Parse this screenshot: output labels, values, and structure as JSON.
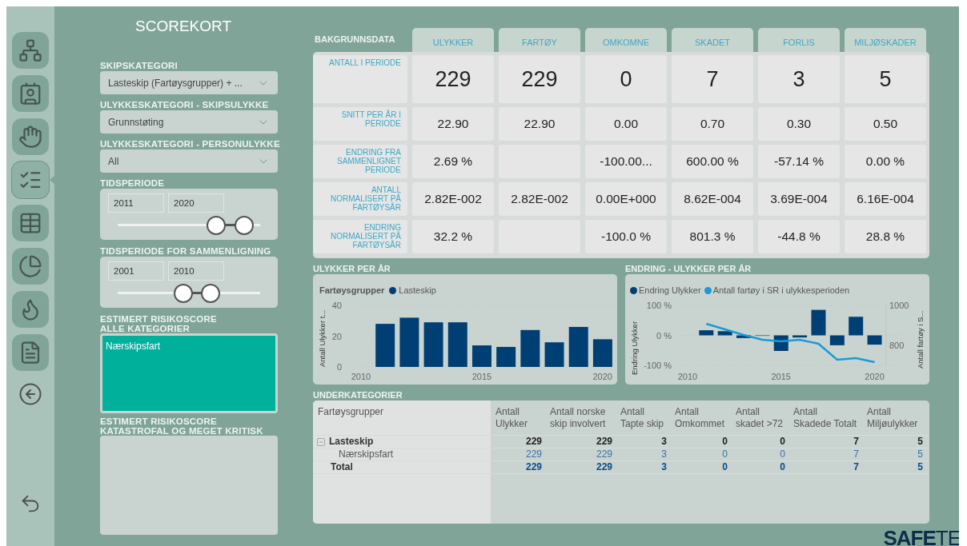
{
  "sidebar": {
    "nav_items": [
      {
        "kind": "network",
        "selected": false
      },
      {
        "kind": "contact",
        "selected": false
      },
      {
        "kind": "hand",
        "selected": false
      },
      {
        "kind": "checklist",
        "selected": true
      },
      {
        "kind": "table",
        "selected": false
      },
      {
        "kind": "pie",
        "selected": false
      },
      {
        "kind": "flame",
        "selected": false
      },
      {
        "kind": "document",
        "selected": false
      }
    ]
  },
  "filters": {
    "title": "SCOREKORT",
    "dropdowns": [
      {
        "label": "SKIPSKATEGORI",
        "value": "Lasteskip (Fartøysgrupper) + ..."
      },
      {
        "label": "ULYKKESKATEGORI - SKIPSULYKKE",
        "value": "Grunnstøting"
      },
      {
        "label": "ULYKKESKATEGORI - PERSONULYKKE",
        "value": "All"
      }
    ],
    "ranges": [
      {
        "label": "TIDSPERIODE",
        "from": "2011",
        "to": "2020",
        "thumbs": [
          {
            "level": 0.69
          },
          {
            "level": 0.89
          }
        ]
      },
      {
        "label": "TIDSPERIODE FOR SAMMENLIGNING",
        "from": "2001",
        "to": "2010",
        "thumbs": [
          {
            "level": 0.46
          },
          {
            "level": 0.65
          }
        ]
      }
    ],
    "risk_boxes": [
      {
        "label": [
          "ESTIMERT RISIKOSCORE",
          "ALLE KATEGORIER"
        ],
        "color": "#00b09b",
        "items": [
          "Nærskipsfart"
        ]
      },
      {
        "label": [
          "ESTIMERT RISIKOSCORE",
          "KATASTROFAL OG MEGET KRITISK"
        ]
      }
    ]
  },
  "scorecard": {
    "title": "BAKGRUNNSDATA",
    "columns": [
      "ULYKKER",
      "FARTØY",
      "OMKOMNE",
      "SKADET",
      "FORLIS",
      "MILJØSKADER"
    ],
    "rows": [
      {
        "label": "ANTALL I PERIODE",
        "values": [
          {
            "text": "229"
          },
          {
            "text": "229"
          },
          {
            "text": "0"
          },
          {
            "text": "7"
          },
          {
            "text": "3"
          },
          {
            "text": "5"
          }
        ]
      },
      {
        "label": "SNITT PER ÅR I PERIODE",
        "values": [
          {
            "text": "22.90"
          },
          {
            "text": "22.90"
          },
          {
            "text": "0.00"
          },
          {
            "text": "0.70"
          },
          {
            "text": "0.30"
          },
          {
            "text": "0.50"
          }
        ]
      },
      {
        "label": "ENDRING FRA SAMMENLIGNET PERIODE",
        "values": [
          {
            "text": "2.69 %"
          },
          {
            "empty": true
          },
          {
            "text": "-100.00..."
          },
          {
            "text": "600.00 %"
          },
          {
            "text": "-57.14 %"
          },
          {
            "text": "0.00 %"
          }
        ]
      },
      {
        "label": "ANTALL NORMALISERT PÅ FARTØYSÅR",
        "values": [
          {
            "text": "2.82E-002"
          },
          {
            "text": "2.82E-002"
          },
          {
            "text": "0.00E+000"
          },
          {
            "text": "8.62E-004"
          },
          {
            "text": "3.69E-004"
          },
          {
            "text": "6.16E-004"
          }
        ]
      },
      {
        "label": "ENDRING NORMALISERT PÅ FARTØYSÅR",
        "values": [
          {
            "text": "32.2 %"
          },
          {
            "empty": true
          },
          {
            "text": "-100.0 %"
          },
          {
            "text": "801.3 %"
          },
          {
            "text": "-44.8 %"
          },
          {
            "text": "28.8 %"
          }
        ]
      }
    ]
  },
  "charts": [
    {
      "title": "ULYKKER PER ÅR",
      "chart_data": {
        "type": "bar",
        "legend": "top",
        "title": "Fartøysgrupper",
        "ylabel": "Antall Ulykker t...",
        "x": [
          2011,
          2012,
          2013,
          2014,
          2015,
          2016,
          2017,
          2018,
          2019,
          2020
        ],
        "series": [
          {
            "name": "Lasteskip",
            "color": "#003f74",
            "values": [
              28,
              32,
              29,
              29,
              14,
              13,
              24,
              16,
              26,
              18
            ]
          }
        ],
        "xlim": [
          2010,
          2020.5
        ],
        "ylim": [
          0,
          40
        ],
        "xticks": [
          2010,
          2015,
          2020
        ],
        "yticks": [
          0,
          20,
          40
        ]
      }
    },
    {
      "title": "ENDRING - ULYKKER PER ÅR",
      "chart_data": {
        "type": "bar",
        "legend": "top",
        "ylabel": "Endring Ulykker",
        "y2label": "Antall fartøy i S...",
        "x": [
          2011,
          2012,
          2013,
          2014,
          2015,
          2016,
          2017,
          2018,
          2019,
          2020
        ],
        "series": [
          {
            "name": "Endring Ulykker",
            "type": "bar",
            "color": "#003f74",
            "values": [
              17,
              14,
              -9,
              0,
              -52,
              -7,
              85,
              -33,
              62,
              -31
            ]
          },
          {
            "name": "Antall fartøy i SR i ulykkesperioden",
            "type": "line",
            "axis": "y2",
            "color": "#1a9ad6",
            "values": [
              908,
              880,
              852,
              828,
              820,
              828,
              808,
              728,
              736,
              716
            ]
          }
        ],
        "xlim": [
          2009.6,
          2021.5
        ],
        "ylim": [
          -100,
          100
        ],
        "y2lim": [
          700,
          1000
        ],
        "xticks": [
          2010,
          2015,
          2020
        ],
        "yticks": [
          {
            "value": -100,
            "label": "-100 %"
          },
          {
            "value": 0,
            "label": "0 %"
          },
          {
            "value": 100,
            "label": "100 %"
          }
        ],
        "y2ticks": [
          800,
          1000
        ]
      }
    }
  ],
  "subcategories": {
    "title": "UNDERKATEGORIER",
    "row_header": "Fartøysgrupper",
    "columns": [
      "Antall Ulykker",
      "Antall norske skip involvert",
      "Antall Tapte skip",
      "Antall Omkommet",
      "Antall skadet >72",
      "Antall Skadede Totalt",
      "Antall Miljøulykker"
    ],
    "rows": [
      {
        "kind": "group",
        "expanded": true,
        "label": "Lasteskip",
        "values": [
          "229",
          "229",
          "3",
          "0",
          "0",
          "7",
          "5"
        ]
      },
      {
        "kind": "child",
        "label": "Nærskipsfart",
        "values": [
          "229",
          "229",
          "3",
          "0",
          "0",
          "7",
          "5"
        ]
      },
      {
        "kind": "total",
        "label": "Total",
        "values": [
          "229",
          "229",
          "3",
          "0",
          "0",
          "7",
          "5"
        ]
      }
    ]
  },
  "logo": {
    "strong": "SAFE",
    "light": "TE"
  }
}
